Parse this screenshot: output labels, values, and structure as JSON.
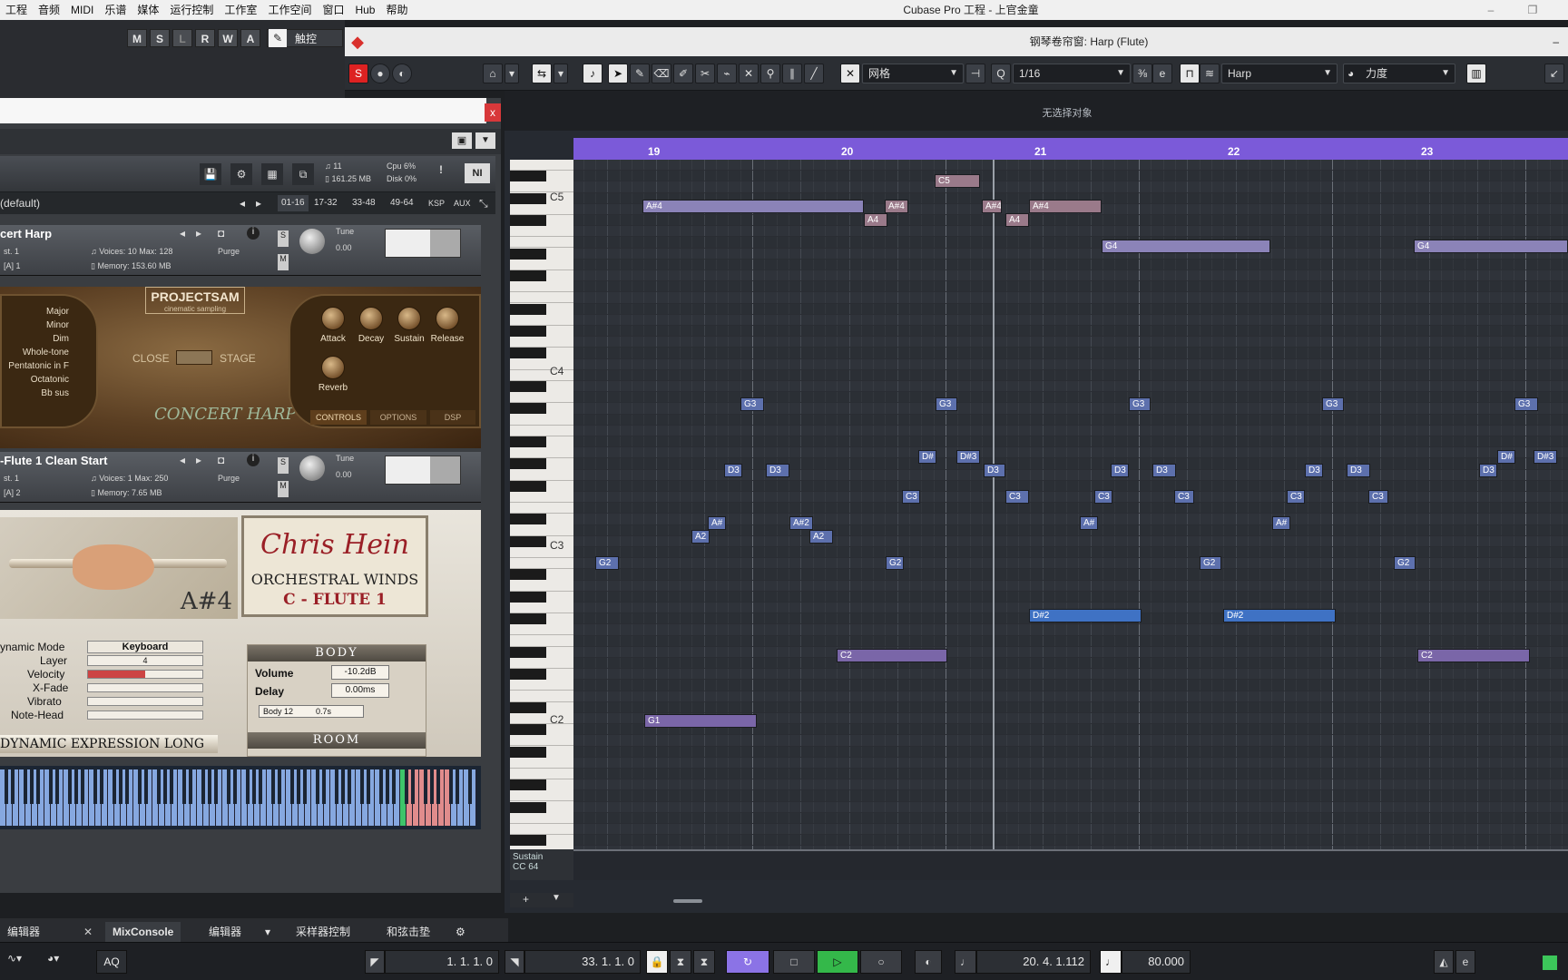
{
  "menubar": {
    "items": [
      "工程",
      "音频",
      "MIDI",
      "乐谱",
      "媒体",
      "运行控制",
      "工作室",
      "工作空间",
      "窗口",
      "Hub",
      "帮助"
    ],
    "app_title": "Cubase Pro 工程 - 上官金童"
  },
  "track_buttons": [
    "M",
    "S",
    "L",
    "R",
    "W",
    "A"
  ],
  "touch_label": "触控",
  "piano_roll": {
    "window_title": "钢琴卷帘窗: Harp (Flute)",
    "status": "无选择对象",
    "grid_mode": "网格",
    "quantize": "1/16",
    "track": "Harp",
    "controller": "力度",
    "bars": [
      "19",
      "20",
      "21",
      "22",
      "23"
    ],
    "key_labels": [
      "C5",
      "C4",
      "C3",
      "C2"
    ],
    "cc_lane": {
      "name": "Sustain",
      "cc": "CC 64"
    },
    "notes": [
      "C5",
      "A#4",
      "A#4",
      "A#4",
      "A#4",
      "A4",
      "A4",
      "G4",
      "G4",
      "G3",
      "G3",
      "G3",
      "G3",
      "G3",
      "D#",
      "D#3",
      "D#",
      "D#3",
      "D3",
      "D3",
      "D3",
      "D3",
      "D3",
      "D3",
      "D3",
      "D3",
      "C3",
      "C3",
      "C3",
      "C3",
      "C3",
      "C3",
      "A#",
      "A#2",
      "A#",
      "A#",
      "A2",
      "A2",
      "G2",
      "G2",
      "G2",
      "G2",
      "D#2",
      "D#2",
      "C2",
      "C2",
      "G1"
    ]
  },
  "kontakt": {
    "preset": "(default)",
    "rack_pages": [
      "01-16",
      "17-32",
      "33-48",
      "49-64",
      "KSP",
      "AUX"
    ],
    "cpu": "Cpu 6%",
    "disk": "Disk 0%",
    "voices_total": "11",
    "memory_total": "161.25 MB",
    "instruments": [
      {
        "name": "cert Harp",
        "out": "st. 1",
        "midi": "[A] 1",
        "voices": "10",
        "max": "128",
        "purge": "Purge",
        "memory": "153.60 MB",
        "tune": "Tune",
        "tune_val": "0.00"
      },
      {
        "name": "-Flute 1 Clean Start",
        "out": "st. 1",
        "midi": "[A] 2",
        "voices": "1",
        "max": "250",
        "purge": "Purge",
        "memory": "7.65 MB",
        "tune": "Tune",
        "tune_val": "0.00"
      }
    ],
    "harp_ui": {
      "brand": "PROJECTSAM",
      "brand_sub": "cinematic sampling",
      "scales": [
        "Major",
        "Minor",
        "Dim",
        "Whole-tone",
        "Pentatonic in F",
        "Octatonic",
        "Bb sus"
      ],
      "close": "CLOSE",
      "stage": "STAGE",
      "knobs": [
        "Attack",
        "Decay",
        "Sustain",
        "Release",
        "Reverb"
      ],
      "tabs": [
        "CONTROLS",
        "OPTIONS",
        "DSP"
      ],
      "logo": "CONCERT HARP EXP"
    },
    "flute_ui": {
      "note": "A#4",
      "author": "Chris Hein",
      "series": "ORCHESTRAL WINDS",
      "instrument": "C - FLUTE 1",
      "params": [
        "ynamic Mode",
        "Layer",
        "Velocity",
        "X-Fade",
        "Vibrato",
        "Note-Head"
      ],
      "keyboard_label": "Keyboard",
      "layer_value": "4",
      "body_header": "BODY",
      "volume_label": "Volume",
      "volume": "-10.2dB",
      "delay_label": "Delay",
      "delay": "0.00ms",
      "body_preset": "Body 12",
      "body_time": "0.7s",
      "room_header": "ROOM",
      "expression": "DYNAMIC EXPRESSION LONG"
    }
  },
  "bottom_tabs": [
    "编辑器",
    "MixConsole",
    "编辑器",
    "采样器控制",
    "和弦击垫"
  ],
  "transport": {
    "aq": "AQ",
    "left_locator": "1. 1. 1.   0",
    "right_locator": "33. 1. 1.   0",
    "position": "20. 4. 1.112",
    "tempo": "80.000"
  }
}
